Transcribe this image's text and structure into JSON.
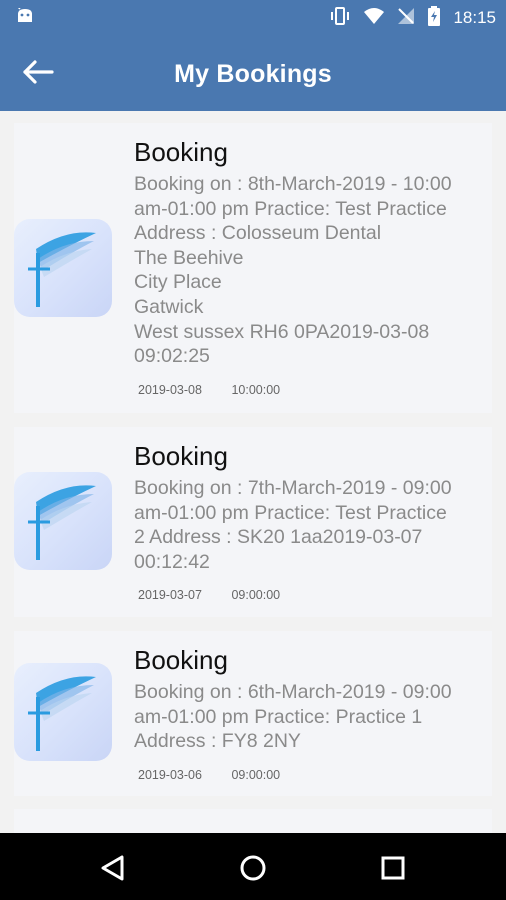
{
  "status_bar": {
    "time": "18:15",
    "icons": [
      "android-icon",
      "vibrate-icon",
      "wifi-icon",
      "no-signal-icon",
      "battery-charging-icon"
    ]
  },
  "header": {
    "title": "My Bookings",
    "back_icon": "arrow-left-icon"
  },
  "bookings": [
    {
      "title": "Booking",
      "details": "Booking on : 8th-March-2019 - 10:00\nam-01:00 pm Practice: Test Practice\nAddress : Colosseum Dental\nThe Beehive\nCity Place\nGatwick\nWest sussex RH6 0PA2019-03-08\n09:02:25",
      "date": "2019-03-08",
      "time": "10:00:00"
    },
    {
      "title": "Booking",
      "details": "Booking on : 7th-March-2019 - 09:00\nam-01:00 pm Practice: Test Practice\n2 Address : SK20 1aa2019-03-07\n00:12:42",
      "date": "2019-03-07",
      "time": "09:00:00"
    },
    {
      "title": "Booking",
      "details": "Booking on : 6th-March-2019 - 09:00\nam-01:00 pm Practice: Practice 1\nAddress : FY8 2NY",
      "date": "2019-03-06",
      "time": "09:00:00"
    }
  ],
  "colors": {
    "app_bar": "#4a78b0",
    "card_bg": "#f4f5f8",
    "logo_blue": "#2a9be0"
  },
  "nav_bar": {
    "buttons": [
      "back-triangle-icon",
      "home-circle-icon",
      "recents-square-icon"
    ]
  }
}
